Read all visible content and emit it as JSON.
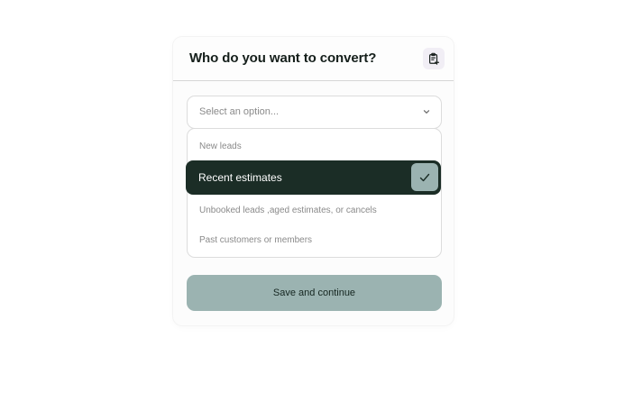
{
  "modal": {
    "title": "Who do you want to convert?",
    "header_icon": "clipboard-add-icon"
  },
  "select": {
    "placeholder": "Select an option...",
    "chevron_icon": "chevron-down-icon"
  },
  "options": [
    {
      "label": "New leads",
      "selected": false
    },
    {
      "label": "Recent estimates",
      "selected": true
    },
    {
      "label": "Unbooked leads ,aged estimates, or cancels",
      "selected": false
    },
    {
      "label": "Past customers or members",
      "selected": false
    }
  ],
  "check_icon": "check-icon",
  "actions": {
    "save_label": "Save and continue"
  },
  "colors": {
    "selected_bg": "#1b2d26",
    "accent": "#9bb3b1",
    "icon_bg": "#f1eef5"
  }
}
